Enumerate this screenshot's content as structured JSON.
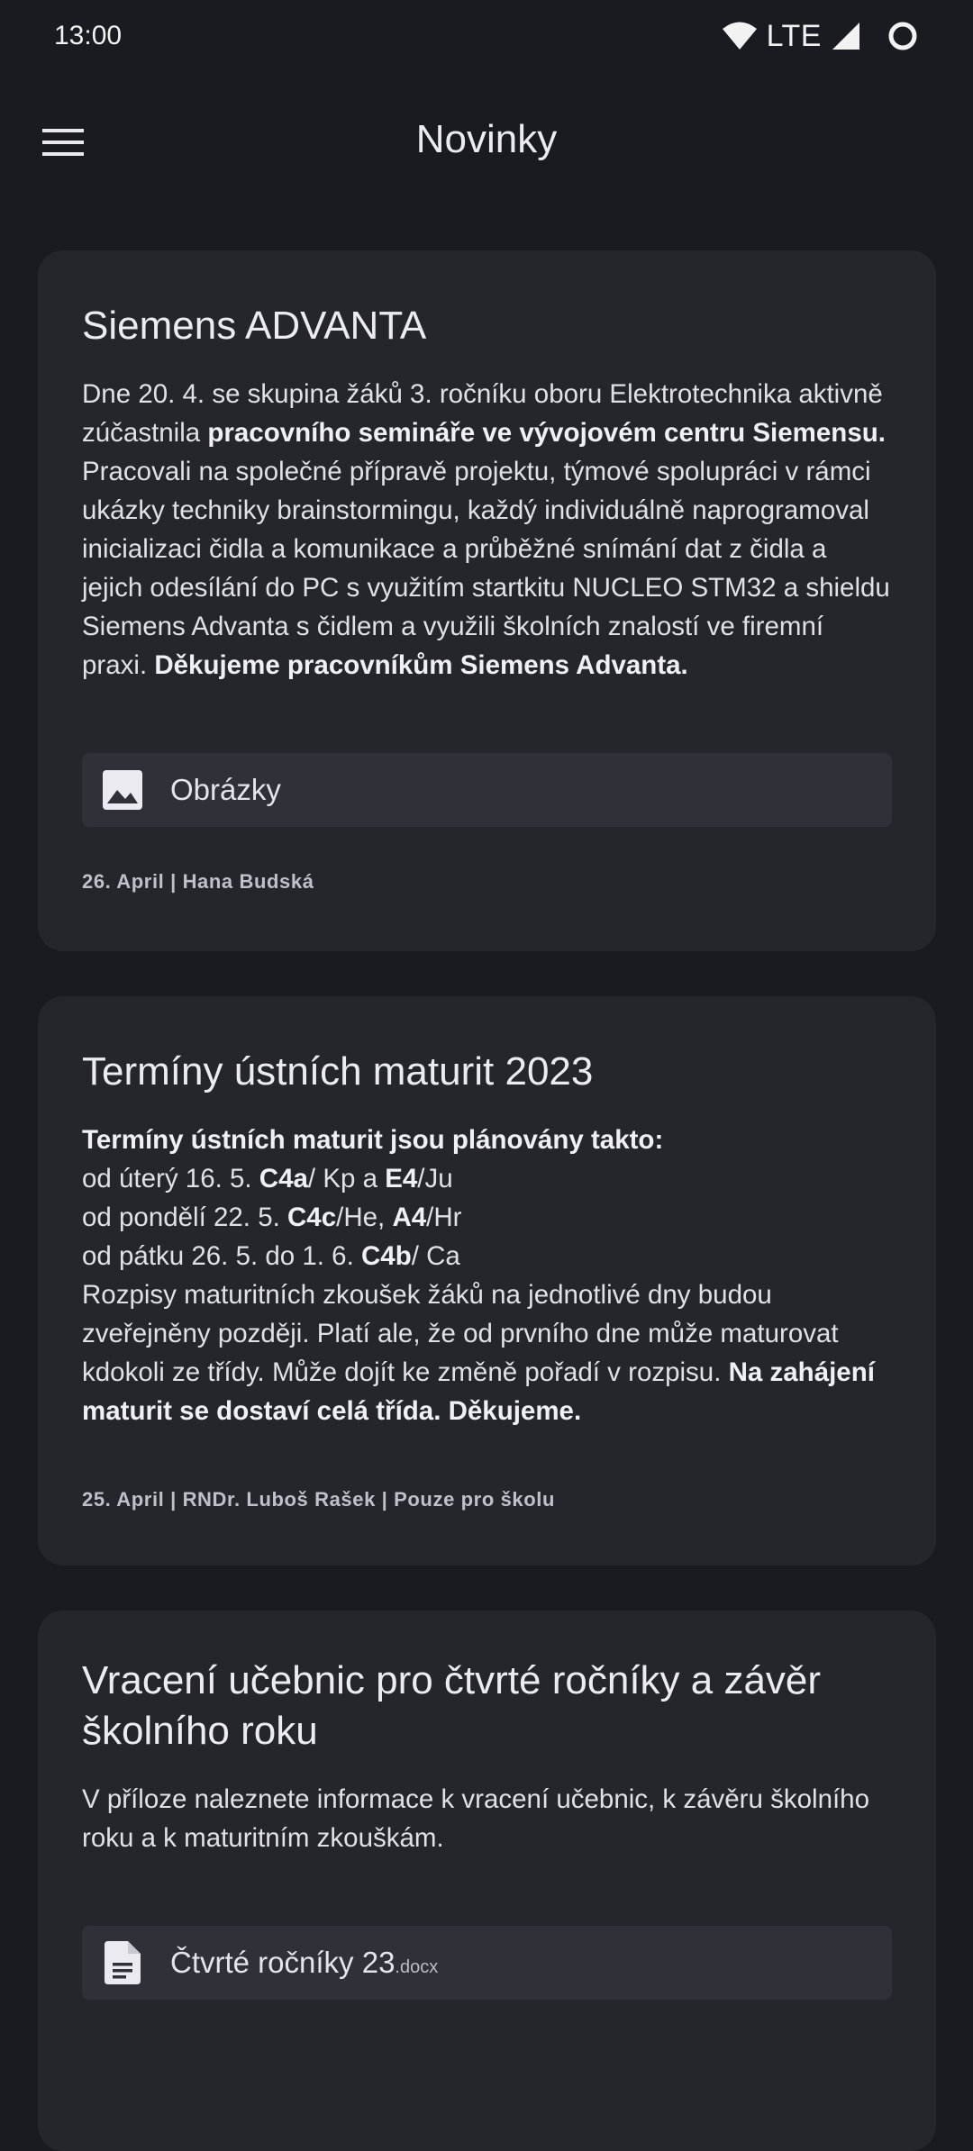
{
  "status_bar": {
    "time": "13:00",
    "network": "LTE"
  },
  "app_bar": {
    "title": "Novinky"
  },
  "posts": [
    {
      "title": "Siemens ADVANTA",
      "body": {
        "t1": "Dne 20. 4. se skupina žáků 3. ročníku oboru Elektrotechnika aktivně",
        "t2": "zúčastnila ",
        "b1": "pracovního semináře ve vývojovém centru Siemensu.",
        "t3": "Pracovali na společné přípravě projektu, týmové spolupráci v rámci",
        "t4": "ukázky techniky brainstormingu, každý individuálně naprogramoval",
        "t5": "inicializaci čidla a komunikace a průběžné snímání dat z čidla a",
        "t6": "jejich odesílání do PC s využitím startkitu NUCLEO STM32 a shieldu",
        "t7": "Siemens Advanta s čidlem a využili školních znalostí ve firemní",
        "t8": "praxi. ",
        "b2": "Děkujeme pracovníkům Siemens Advanta."
      },
      "attachment": {
        "label": "Obrázky",
        "icon": "image-icon"
      },
      "meta": "26. April | Hana Budská"
    },
    {
      "title": "Termíny ústních maturit 2023",
      "body": {
        "b1": "Termíny ústních maturit jsou plánovány takto:",
        "l1a": "od úterý 16. 5. ",
        "l1b": "C4a",
        "l1c": "/ Kp a ",
        "l1d": "E4",
        "l1e": "/Ju",
        "l2a": "od pondělí 22. 5. ",
        "l2b": "C4c",
        "l2c": "/He, ",
        "l2d": "A4",
        "l2e": "/Hr",
        "l3a": "od pátku 26. 5. do 1. 6. ",
        "l3b": "C4b",
        "l3c": "/ Ca",
        "t1": "Rozpisy maturitních zkoušek žáků na jednotlivé dny budou",
        "t2": "zveřejněny později. Platí ale, že od prvního dne může maturovat",
        "t3": "kdokoli ze třídy. Může dojít ke změně pořadí v rozpisu. ",
        "b2": "Na zahájení",
        "b3": "maturit se dostaví celá třída. Děkujeme."
      },
      "meta": "25. April | RNDr. Luboš Rašek | Pouze pro školu"
    },
    {
      "title_line1": "Vracení učebnic pro čtvrté ročníky a závěr",
      "title_line2": "školního roku",
      "body": {
        "t1": "V příloze naleznete informace k vracení učebnic, k závěru školního",
        "t2": "roku a k maturitním zkouškám."
      },
      "attachment": {
        "label": "Čtvrté ročníky 23",
        "ext": ".docx",
        "icon": "document-icon"
      }
    }
  ]
}
